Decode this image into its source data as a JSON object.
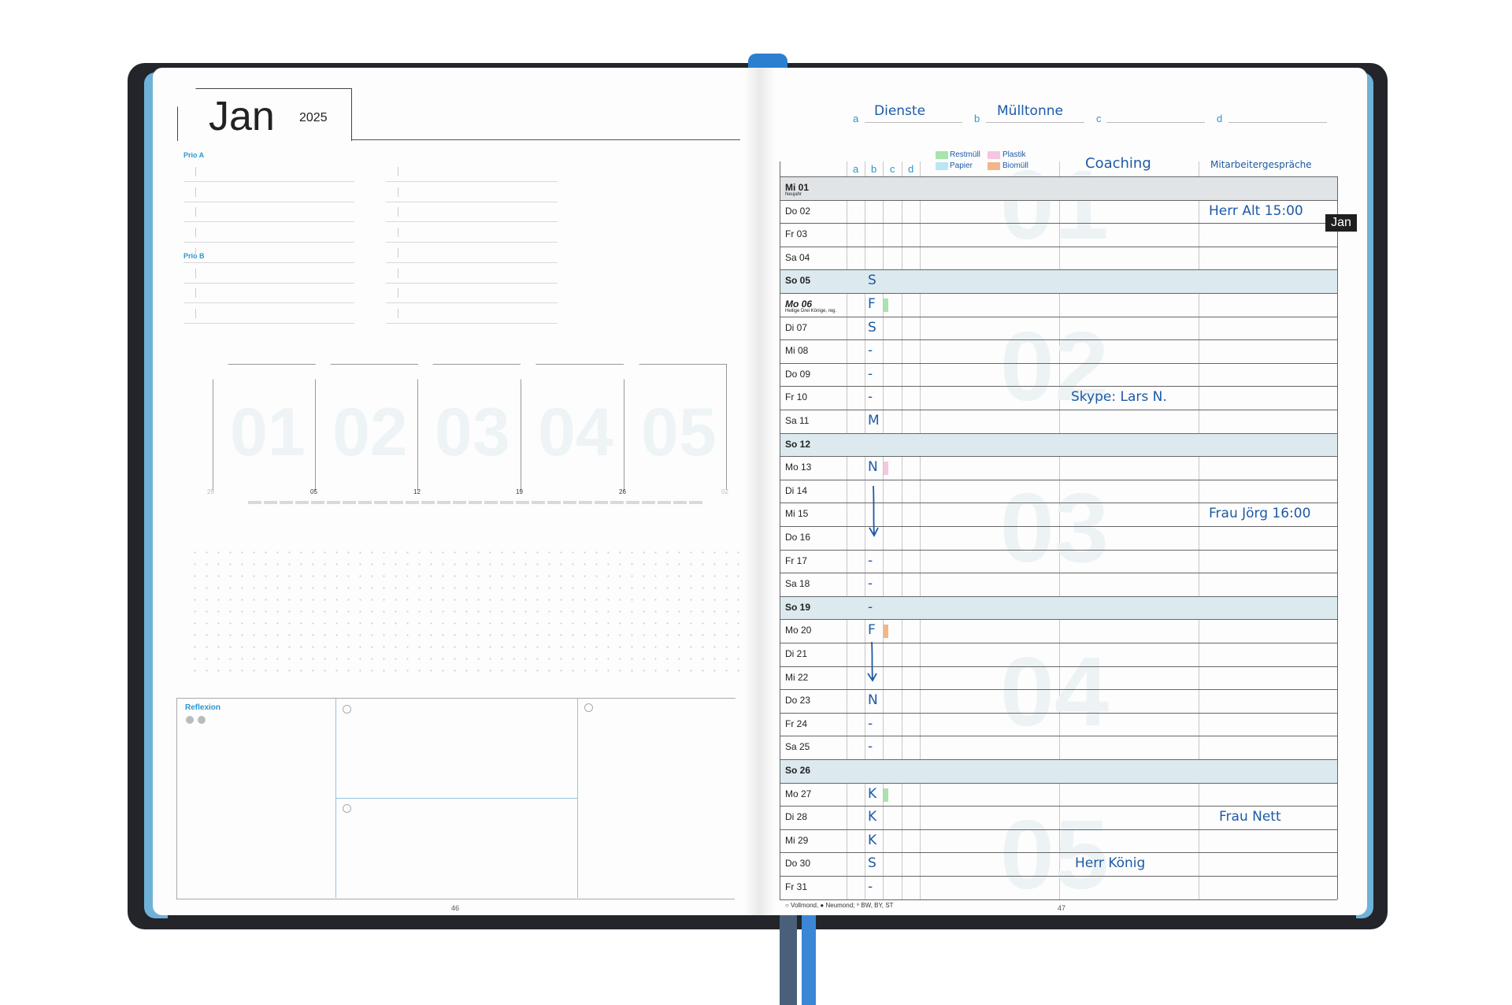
{
  "left_page": {
    "month": "Jan",
    "year": "2025",
    "prio_a_label": "Prio A",
    "prio_b_label": "Prio B",
    "week_numbers": [
      "01",
      "02",
      "03",
      "04",
      "05"
    ],
    "week_start_dates": [
      "29",
      "05",
      "12",
      "19",
      "26",
      "02"
    ],
    "reflexion_label": "Reflexion",
    "page_number": "46"
  },
  "right_page": {
    "header": {
      "col_a_letter": "a",
      "col_a_title": "Dienste",
      "col_b_letter": "b",
      "col_b_title": "Mülltonne",
      "col_c_letter": "c",
      "col_c_title": "",
      "col_d_letter": "d",
      "col_d_title": ""
    },
    "column_letters": [
      "a",
      "b",
      "c",
      "d"
    ],
    "legend": [
      {
        "label": "Restmüll",
        "color": "#a9e3ad"
      },
      {
        "label": "Plastik",
        "color": "#f6c6e0"
      },
      {
        "label": "Papier",
        "color": "#b9e6f3"
      },
      {
        "label": "Biomüll",
        "color": "#f3b58a"
      }
    ],
    "section_titles": {
      "coaching": "Coaching",
      "mitarbeiter": "Mitarbeitergespräche"
    },
    "month_tab": "Jan",
    "week_watermarks": [
      "01",
      "02",
      "03",
      "04",
      "05"
    ],
    "days": [
      {
        "label": "Mi 01",
        "bold": true,
        "holiday": "Neujahr",
        "duty": "",
        "bin": "",
        "coaching": "",
        "mitarbeiter": ""
      },
      {
        "label": "Do 02",
        "duty": "",
        "bin": "",
        "coaching": "",
        "mitarbeiter": "Herr Alt 15:00"
      },
      {
        "label": "Fr 03",
        "duty": "",
        "bin": "",
        "coaching": "",
        "mitarbeiter": ""
      },
      {
        "label": "Sa 04",
        "duty": "",
        "bin": "",
        "coaching": "",
        "mitarbeiter": ""
      },
      {
        "label": "So 05",
        "sunday": true,
        "bold": true,
        "duty": "S",
        "bin": "",
        "coaching": "",
        "mitarbeiter": ""
      },
      {
        "label": "Mo 06",
        "bold": true,
        "italic": true,
        "holiday": "Heilige Drei Könige, reg.",
        "duty": "F",
        "bin": "restmuell",
        "coaching": "",
        "mitarbeiter": ""
      },
      {
        "label": "Di 07",
        "duty": "S",
        "bin": "",
        "coaching": "",
        "mitarbeiter": ""
      },
      {
        "label": "Mi 08",
        "duty": "-",
        "bin": "",
        "coaching": "",
        "mitarbeiter": ""
      },
      {
        "label": "Do 09",
        "duty": "-",
        "bin": "",
        "coaching": "",
        "mitarbeiter": ""
      },
      {
        "label": "Fr 10",
        "duty": "-",
        "bin": "",
        "coaching": "Skype: Lars N.",
        "mitarbeiter": ""
      },
      {
        "label": "Sa 11",
        "duty": "M",
        "bin": "",
        "coaching": "",
        "mitarbeiter": ""
      },
      {
        "label": "So 12",
        "sunday": true,
        "bold": true,
        "duty": "",
        "bin": "",
        "coaching": "",
        "mitarbeiter": ""
      },
      {
        "label": "Mo 13",
        "duty": "N",
        "bin": "plastik",
        "coaching": "",
        "mitarbeiter": ""
      },
      {
        "label": "Di 14",
        "duty": "",
        "bin": "",
        "coaching": "",
        "mitarbeiter": ""
      },
      {
        "label": "Mi 15",
        "duty": "",
        "bin": "",
        "coaching": "",
        "mitarbeiter": "Frau Jörg 16:00"
      },
      {
        "label": "Do 16",
        "duty": "",
        "bin": "",
        "coaching": "",
        "mitarbeiter": ""
      },
      {
        "label": "Fr 17",
        "duty": "-",
        "bin": "",
        "coaching": "",
        "mitarbeiter": ""
      },
      {
        "label": "Sa 18",
        "duty": "-",
        "bin": "",
        "coaching": "",
        "mitarbeiter": ""
      },
      {
        "label": "So 19",
        "sunday": true,
        "bold": true,
        "duty": "-",
        "bin": "",
        "coaching": "",
        "mitarbeiter": ""
      },
      {
        "label": "Mo 20",
        "duty": "F",
        "bin": "biomuell",
        "coaching": "",
        "mitarbeiter": ""
      },
      {
        "label": "Di 21",
        "duty": "",
        "bin": "",
        "coaching": "",
        "mitarbeiter": ""
      },
      {
        "label": "Mi 22",
        "duty": "",
        "bin": "",
        "coaching": "",
        "mitarbeiter": ""
      },
      {
        "label": "Do 23",
        "duty": "N",
        "bin": "",
        "coaching": "",
        "mitarbeiter": ""
      },
      {
        "label": "Fr 24",
        "duty": "-",
        "bin": "",
        "coaching": "",
        "mitarbeiter": ""
      },
      {
        "label": "Sa 25",
        "duty": "-",
        "bin": "",
        "coaching": "",
        "mitarbeiter": ""
      },
      {
        "label": "So 26",
        "sunday": true,
        "bold": true,
        "duty": "",
        "bin": "",
        "coaching": "",
        "mitarbeiter": ""
      },
      {
        "label": "Mo 27",
        "duty": "K",
        "bin": "restmuell",
        "coaching": "",
        "mitarbeiter": ""
      },
      {
        "label": "Di 28",
        "duty": "K",
        "bin": "",
        "coaching": "",
        "mitarbeiter": "Frau Nett"
      },
      {
        "label": "Mi 29",
        "duty": "K",
        "bin": "",
        "coaching": "",
        "mitarbeiter": ""
      },
      {
        "label": "Do 30",
        "duty": "S",
        "bin": "",
        "coaching": "Herr König",
        "mitarbeiter": ""
      },
      {
        "label": "Fr 31",
        "duty": "-",
        "bin": "",
        "coaching": "",
        "mitarbeiter": ""
      }
    ],
    "footer_legend": "○ Vollmond, ● Neumond; ⁹ BW, BY, ST",
    "page_number": "47"
  }
}
